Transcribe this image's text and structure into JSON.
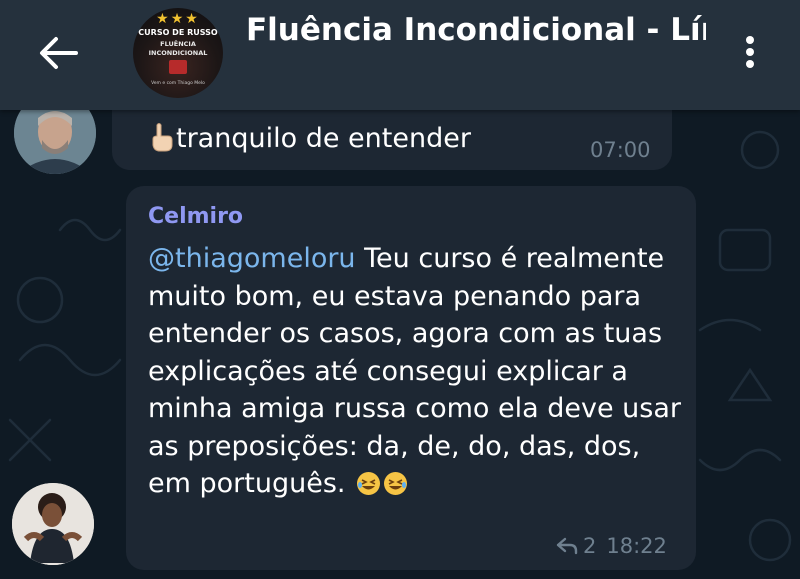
{
  "header": {
    "title": "Fluência Incondicional - Lín",
    "avatar": {
      "stars": "★★★",
      "line1": "CURSO DE RUSSO",
      "line2": "FLUÊNCIA",
      "line3": "INCONDICIONAL",
      "caption": "Vem e com Thiago Melo"
    }
  },
  "messages": [
    {
      "text": "tranquilo de entender",
      "time": "07:00"
    },
    {
      "sender": "Celmiro",
      "mention": "@thiagomeloru",
      "text": " Teu curso é realmente muito bom, eu estava penando para entender os casos, agora com as tuas explicações até consegui explicar a minha amiga russa como ela deve usar as preposições: da, de, do, das, dos, em português.",
      "reply_count": "2",
      "time": "18:22"
    }
  ],
  "colors": {
    "header_bg": "#25313d",
    "chat_bg": "#0f1a24",
    "bubble_bg": "#1d2733",
    "sender_name": "#8f98f2",
    "mention": "#7bb6ec",
    "meta": "#6f808f"
  },
  "icons": {
    "back": "arrow-left-icon",
    "menu": "more-vertical-icon",
    "pointer": "pointing-up-hand-icon",
    "emoji": "rolling-laughing-face-icon",
    "reply": "reply-arrow-icon"
  }
}
